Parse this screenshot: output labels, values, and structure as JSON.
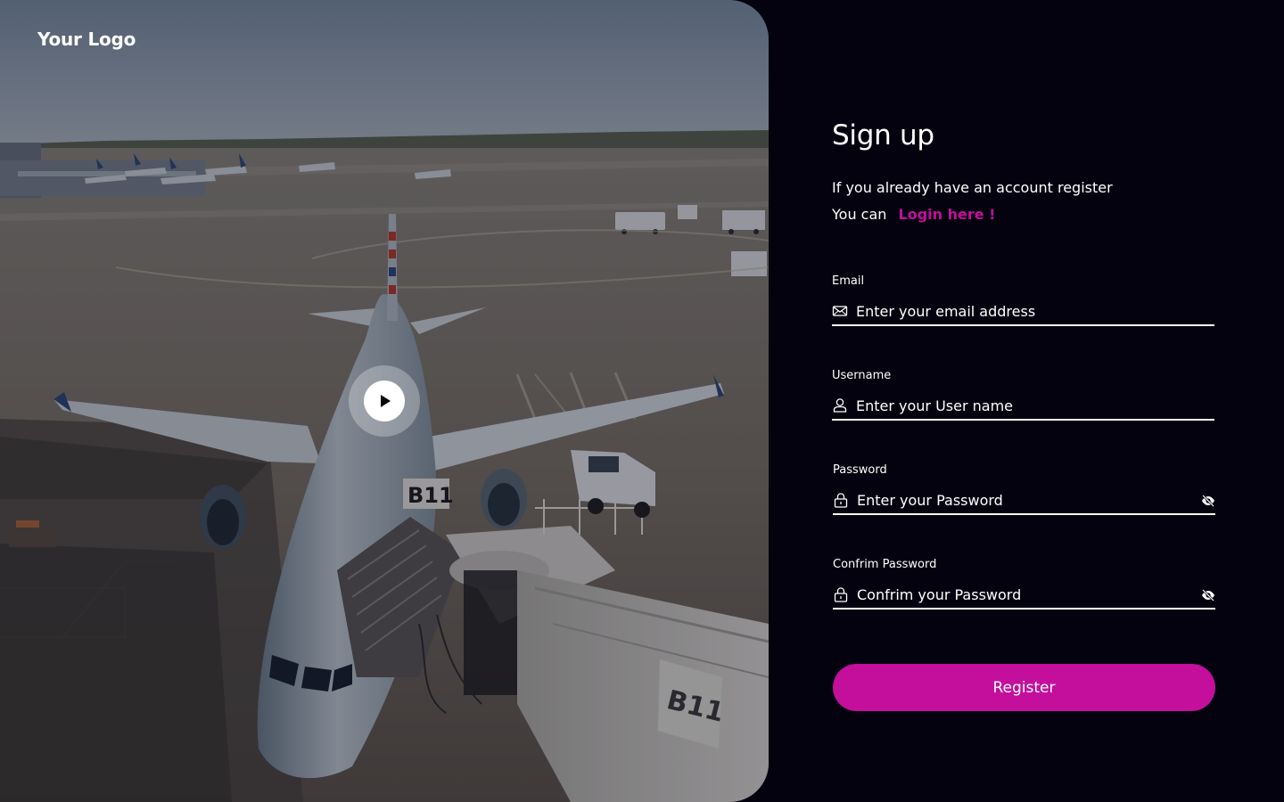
{
  "brand": {
    "logo_text": "Your Logo"
  },
  "hero": {
    "play_icon": "play-icon",
    "jet_bridge_gate": "B11"
  },
  "signup": {
    "title": "Sign up",
    "subtitle": "If you already have an account register",
    "login_prompt": "You can",
    "login_link": "Login here !"
  },
  "form": {
    "email": {
      "label": "Email",
      "placeholder": "Enter your email address",
      "value": "",
      "icon": "mail-icon"
    },
    "username": {
      "label": "Username",
      "placeholder": "Enter your User name",
      "value": "",
      "icon": "user-icon"
    },
    "password": {
      "label": "Password",
      "placeholder": "Enter your Password",
      "value": "",
      "icon": "lock-icon",
      "toggle_icon": "eye-off-icon"
    },
    "confirm_password": {
      "label": "Confrim Password",
      "placeholder": "Confrim your Password",
      "value": "",
      "icon": "lock-icon",
      "toggle_icon": "eye-off-icon"
    },
    "submit_label": "Register"
  },
  "colors": {
    "background": "#04020f",
    "accent": "#c40f9c",
    "text": "#ffffff"
  }
}
